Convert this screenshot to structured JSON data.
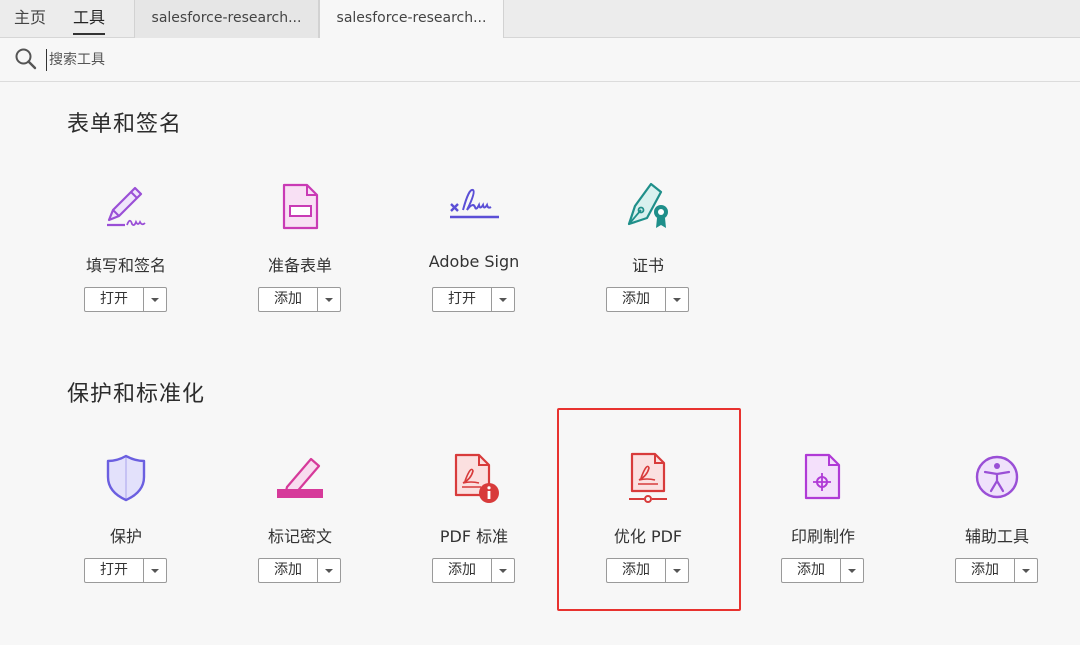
{
  "topbar": {
    "nav": [
      {
        "label": "主页"
      },
      {
        "label": "工具"
      }
    ],
    "doc_tabs": [
      {
        "label": "salesforce-research..."
      },
      {
        "label": "salesforce-research..."
      }
    ]
  },
  "search": {
    "placeholder": "搜索工具"
  },
  "sections": [
    {
      "title": "表单和签名",
      "tools": [
        {
          "name": "填写和签名",
          "button": "打开",
          "icon": "fill-sign-icon"
        },
        {
          "name": "准备表单",
          "button": "添加",
          "icon": "prepare-form-icon"
        },
        {
          "name": "Adobe Sign",
          "button": "打开",
          "icon": "adobe-sign-icon"
        },
        {
          "name": "证书",
          "button": "添加",
          "icon": "certificate-icon"
        }
      ]
    },
    {
      "title": "保护和标准化",
      "tools": [
        {
          "name": "保护",
          "button": "打开",
          "icon": "shield-icon"
        },
        {
          "name": "标记密文",
          "button": "添加",
          "icon": "redact-icon"
        },
        {
          "name": "PDF 标准",
          "button": "添加",
          "icon": "pdf-standards-icon"
        },
        {
          "name": "优化 PDF",
          "button": "添加",
          "icon": "optimize-pdf-icon"
        },
        {
          "name": "印刷制作",
          "button": "添加",
          "icon": "print-production-icon"
        },
        {
          "name": "辅助工具",
          "button": "添加",
          "icon": "accessibility-icon"
        }
      ]
    }
  ],
  "colors": {
    "purple": "#9a4fd6",
    "magenta": "#c93ab5",
    "indigo": "#5b4fd6",
    "teal": "#1f8f8a",
    "red": "#d83b3b",
    "highlight": "#e8322f"
  }
}
